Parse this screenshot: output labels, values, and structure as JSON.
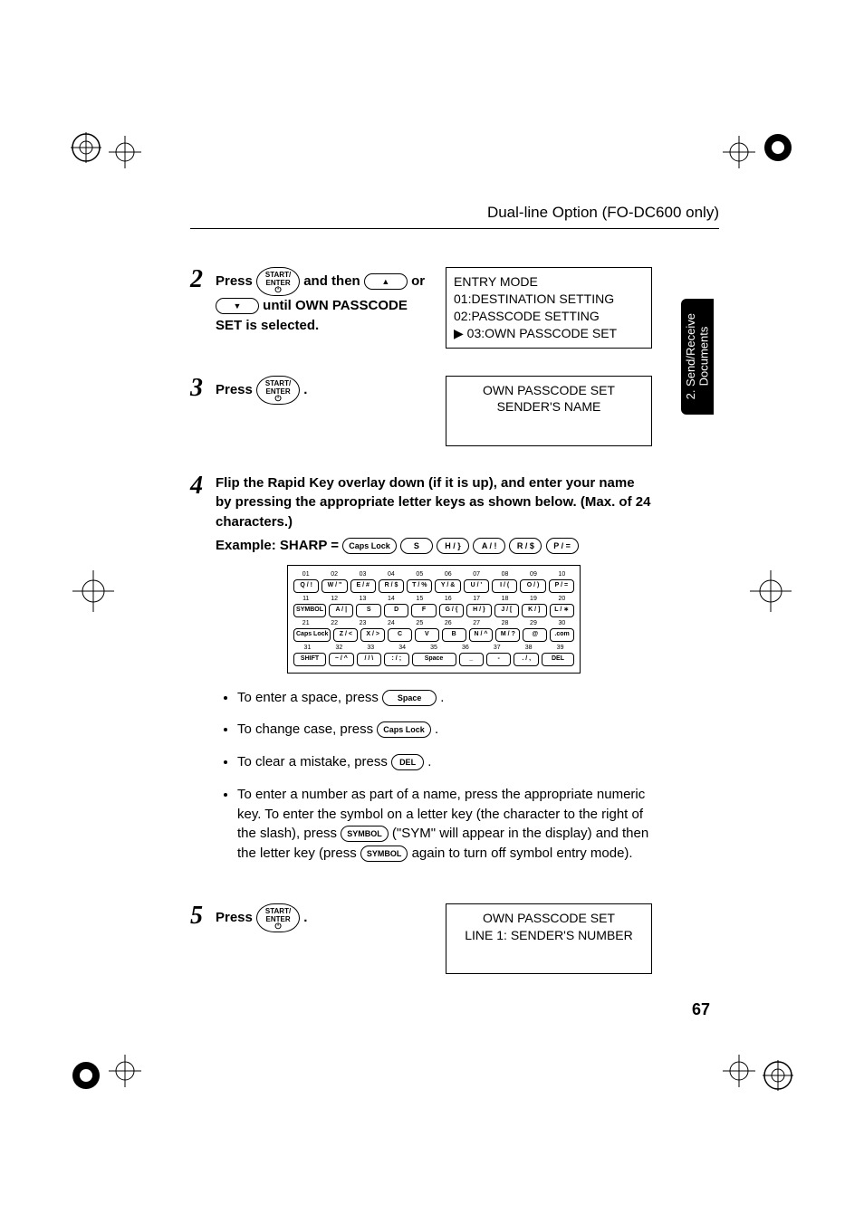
{
  "header": {
    "title": "Dual-line Option (FO-DC600 only)"
  },
  "sidetab": {
    "label": "2. Send/Receive\nDocuments"
  },
  "page_number": "67",
  "start_key": {
    "line1": "START/",
    "line2": "ENTER"
  },
  "step2": {
    "num": "2",
    "pre": "Press ",
    "mid": " and then ",
    "or": " or ",
    "post": " until OWN PASSCODE SET is selected.",
    "display": {
      "l1": "ENTRY MODE",
      "l2": "  01:DESTINATION SETTING",
      "l3": "  02:PASSCODE SETTING",
      "l4": "▶ 03:OWN PASSCODE SET"
    }
  },
  "step3": {
    "num": "3",
    "pre": "Press ",
    "post": ".",
    "display": {
      "l1": "OWN PASSCODE SET",
      "l2": "SENDER'S NAME"
    }
  },
  "step4": {
    "num": "4",
    "body": "Flip the Rapid Key overlay down (if it is up), and enter your name by pressing the appropriate letter keys as shown below. (Max. of 24 characters.)",
    "example_label": "Example: SHARP = ",
    "ex_keys": [
      "Caps Lock",
      "S",
      "H / }",
      "A / !",
      "R / $",
      "P / ="
    ]
  },
  "keyboard": {
    "topnums": [
      "01",
      "02",
      "03",
      "04",
      "05",
      "06",
      "07",
      "08",
      "09",
      "10"
    ],
    "row1": [
      "Q / !",
      "W / \"",
      "E / #",
      "R / $",
      "T / %",
      "Y / &",
      "U / '",
      "I / (",
      "O / )",
      "P / ="
    ],
    "midnums1": [
      "11",
      "12",
      "13",
      "14",
      "15",
      "16",
      "17",
      "18",
      "19",
      "20"
    ],
    "row2_first": "SYMBOL",
    "row2": [
      "A / |",
      "S",
      "D",
      "F",
      "G / {",
      "H / }",
      "J / [",
      "K / ]",
      "L / ∗"
    ],
    "midnums2": [
      "21",
      "22",
      "23",
      "24",
      "25",
      "26",
      "27",
      "28",
      "29",
      "30"
    ],
    "row3_first": "Caps Lock",
    "row3": [
      "Z / <",
      "X / >",
      "C",
      "V",
      "B",
      "N / ^",
      "M / ?",
      "@",
      ".com"
    ],
    "midnums3": [
      "31",
      "32",
      "33",
      "34",
      "35",
      "36",
      "37",
      "38",
      "39"
    ],
    "row4_first": "SHIFT",
    "row4_a": [
      "~ / ^",
      "/ / \\",
      ": / ;"
    ],
    "row4_space": "Space",
    "row4_b": [
      "_",
      "-",
      ". / ,"
    ],
    "row4_last": "DEL"
  },
  "bullets": {
    "b1_pre": "To enter a space, press ",
    "b1_key": "Space",
    "b1_post": ".",
    "b2_pre": "To change case, press ",
    "b2_key": "Caps Lock",
    "b2_post": " .",
    "b3_pre": "To clear a mistake, press ",
    "b3_key": "DEL",
    "b3_post": " .",
    "b4_l1": "To enter a number as part of a name, press the appropriate numeric key. To enter the symbol on a letter key (the character to the right of the slash), press ",
    "b4_key1": "SYMBOL",
    "b4_l2": " (\"SYM\" will appear in the display) and then the letter key (press ",
    "b4_key2": "SYMBOL",
    "b4_l3": " again to turn off symbol entry mode)."
  },
  "step5": {
    "num": "5",
    "pre": "Press ",
    "post": ".",
    "display": {
      "l1": "OWN PASSCODE SET",
      "l2": "LINE 1: SENDER'S NUMBER"
    }
  }
}
